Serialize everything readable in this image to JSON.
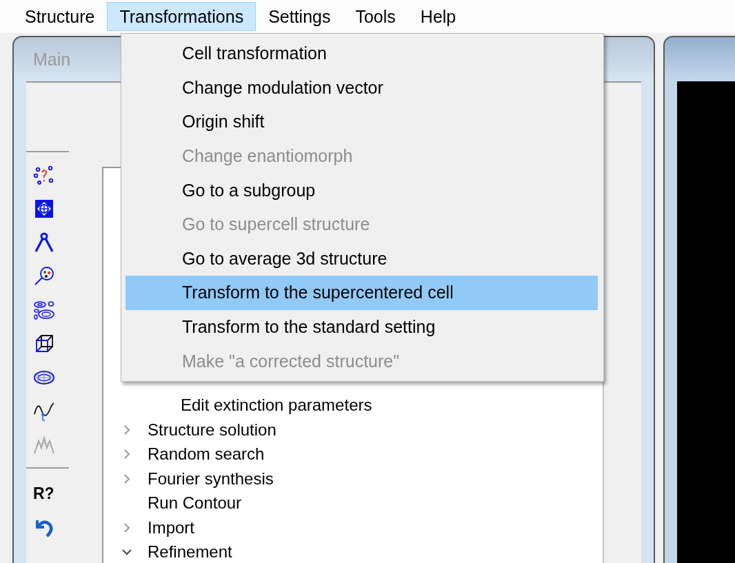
{
  "menubar": [
    {
      "label": "Structure",
      "selected": false
    },
    {
      "label": "Transformations",
      "selected": true
    },
    {
      "label": "Settings",
      "selected": false
    },
    {
      "label": "Tools",
      "selected": false
    },
    {
      "label": "Help",
      "selected": false
    }
  ],
  "menu": {
    "items": [
      {
        "label": "Cell transformation",
        "disabled": false,
        "selected": false
      },
      {
        "label": "Change modulation vector",
        "disabled": false,
        "selected": false
      },
      {
        "label": "Origin shift",
        "disabled": false,
        "selected": false
      },
      {
        "label": "Change enantiomorph",
        "disabled": true,
        "selected": false
      },
      {
        "label": "Go to a subgroup",
        "disabled": false,
        "selected": false
      },
      {
        "label": "Go to supercell structure",
        "disabled": true,
        "selected": false
      },
      {
        "label": "Go to average 3d structure",
        "disabled": false,
        "selected": false
      },
      {
        "label": "Transform to the supercentered cell",
        "disabled": false,
        "selected": true
      },
      {
        "label": "Transform to the standard setting",
        "disabled": false,
        "selected": false
      },
      {
        "label": "Make \"a corrected structure\"",
        "disabled": true,
        "selected": false
      }
    ]
  },
  "main_window": {
    "title": "Main"
  },
  "toolbar": {
    "buttons": [
      {
        "disabled": false
      },
      {
        "disabled": false
      },
      {
        "disabled": false
      },
      {
        "disabled": false
      },
      {
        "disabled": false
      },
      {
        "disabled": false
      },
      {
        "disabled": false
      },
      {
        "disabled": false
      },
      {
        "disabled": true
      },
      {
        "label": "R?",
        "disabled": false
      },
      {
        "disabled": false
      }
    ]
  },
  "tree": {
    "nested_items": [
      {
        "label": "Edit extinction parameters"
      }
    ],
    "items": [
      {
        "label": "Structure solution",
        "kind": "branch",
        "expanded": false
      },
      {
        "label": "Random search",
        "kind": "branch",
        "expanded": false
      },
      {
        "label": "Fourier synthesis",
        "kind": "branch",
        "expanded": false
      },
      {
        "label": "Run Contour",
        "kind": "leaf"
      },
      {
        "label": "Import",
        "kind": "branch",
        "expanded": false
      },
      {
        "label": "Refinement",
        "kind": "branch",
        "expanded": true
      }
    ]
  }
}
